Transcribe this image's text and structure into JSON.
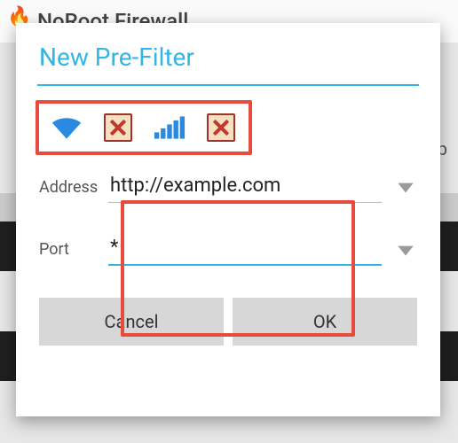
{
  "app": {
    "name": "NoRoot Firewall",
    "helpLabel": "elp"
  },
  "dialog": {
    "title": "New Pre-Filter",
    "toggles": {
      "wifi": "wifi-enabled",
      "wifiBlock": "wifi-block",
      "cell": "cell-enabled",
      "cellBlock": "cell-block"
    },
    "address": {
      "label": "Address",
      "value": "http://example.com"
    },
    "port": {
      "label": "Port",
      "value": "*"
    },
    "buttons": {
      "cancel": "Cancel",
      "ok": "OK"
    }
  },
  "colors": {
    "accent": "#33b5e5",
    "highlight": "#e64b3c"
  }
}
